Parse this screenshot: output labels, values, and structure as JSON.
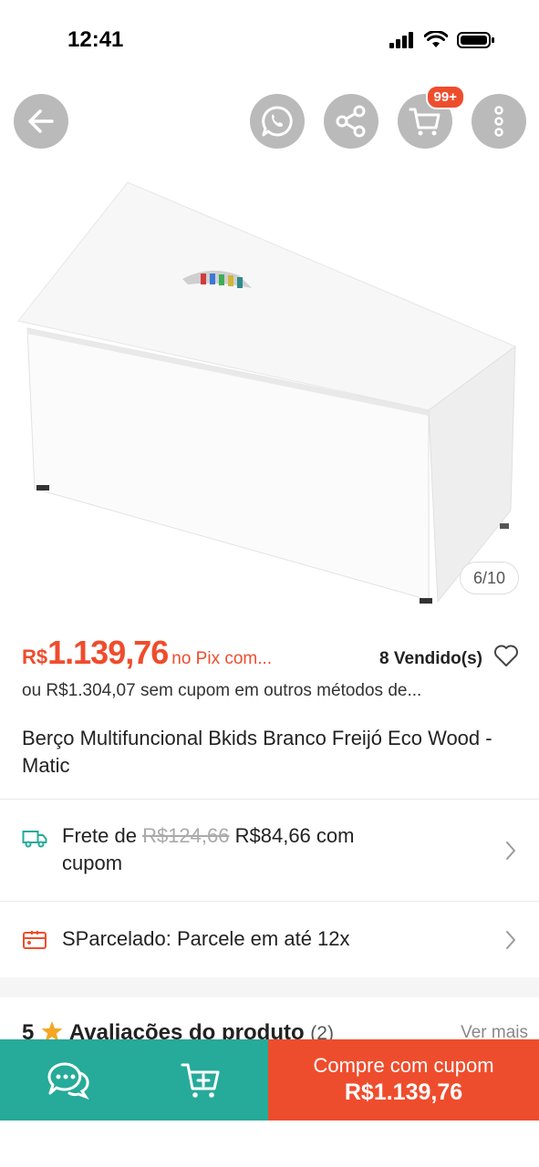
{
  "status_bar": {
    "time": "12:41"
  },
  "top_actions": {
    "cart_badge": "99+"
  },
  "gallery": {
    "counter": "6/10"
  },
  "product": {
    "currency": "R$",
    "price": "1.139,76",
    "price_note": "no Pix com...",
    "sold": "8 Vendido(s)",
    "alt_price": "ou R$1.304,07 sem cupom em outros métodos de...",
    "title": "Berço Multifuncional Bkids Branco Freijó Eco Wood - Matic"
  },
  "shipping": {
    "prefix": "Frete de",
    "old_price": "R$124,66",
    "new_price": "R$84,66 com",
    "suffix": "cupom"
  },
  "installments": {
    "text": "SParcelado: Parcele em até 12x"
  },
  "reviews": {
    "rating": "5",
    "title": "Avaliações do produto",
    "count": "(2)",
    "more": "Ver mais"
  },
  "bottom_bar": {
    "buy_line1": "Compre com cupom",
    "buy_line2": "R$1.139,76"
  },
  "colors": {
    "accent": "#ee4d2d",
    "teal": "#26aa99",
    "star": "#f5a623"
  }
}
